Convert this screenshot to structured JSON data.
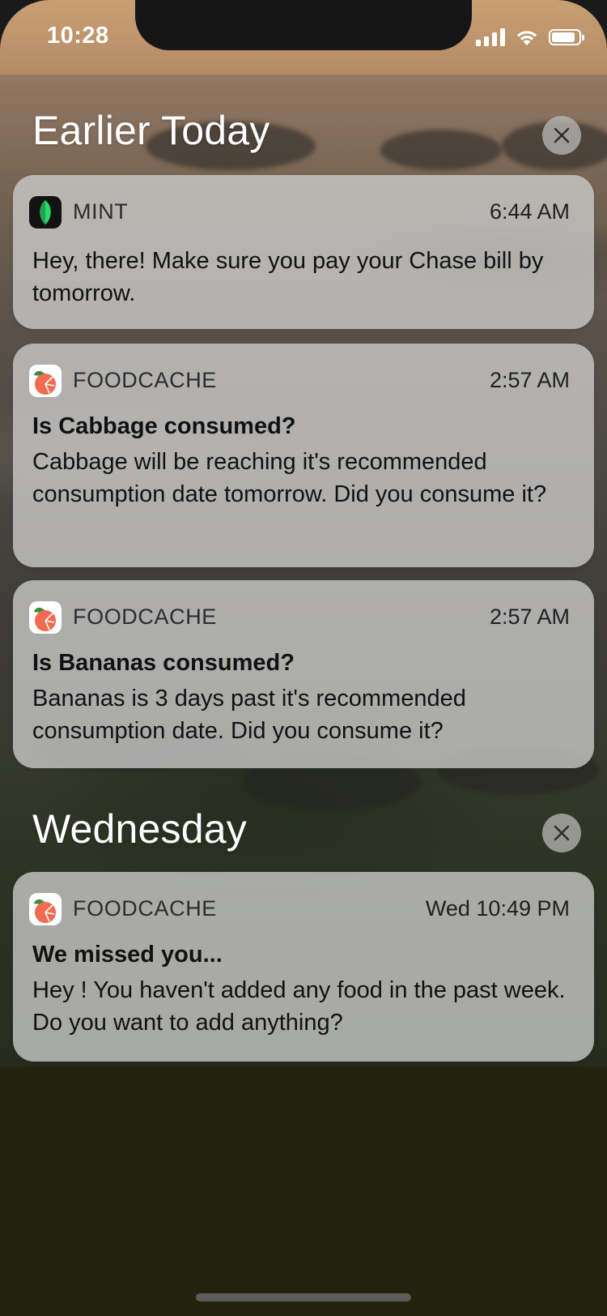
{
  "status_bar": {
    "time": "10:28",
    "signal_icon": "cellular-signal-icon",
    "wifi_icon": "wifi-icon",
    "battery_icon": "battery-icon",
    "battery_level": 0.9
  },
  "sections": [
    {
      "title": "Earlier Today",
      "clear_icon": "close-icon",
      "notifications": [
        {
          "app": "MINT",
          "app_icon": "mint-leaf-icon",
          "app_color": "#2bd86a",
          "time": "6:44 AM",
          "title": "",
          "body": "Hey, there! Make sure you pay your Chase bill by tomorrow."
        },
        {
          "app": "FOODCACHE",
          "app_icon": "foodcache-peach-icon",
          "app_color": "#f06b4f",
          "time": "2:57 AM",
          "title": "Is Cabbage consumed?",
          "body": "Cabbage will be reaching it's recommended consumption date tomorrow. Did you consume it?"
        },
        {
          "app": "FOODCACHE",
          "app_icon": "foodcache-peach-icon",
          "app_color": "#f06b4f",
          "time": "2:57 AM",
          "title": "Is Bananas consumed?",
          "body": "Bananas is 3 days past it's recommended consumption date. Did you consume it?"
        }
      ]
    },
    {
      "title": "Wednesday",
      "clear_icon": "close-icon",
      "notifications": [
        {
          "app": "FOODCACHE",
          "app_icon": "foodcache-peach-icon",
          "app_color": "#f06b4f",
          "time": "Wed 10:49 PM",
          "title": "We missed you...",
          "body": "Hey ! You haven't added any food in the past week. Do you want to add anything?"
        }
      ]
    }
  ]
}
